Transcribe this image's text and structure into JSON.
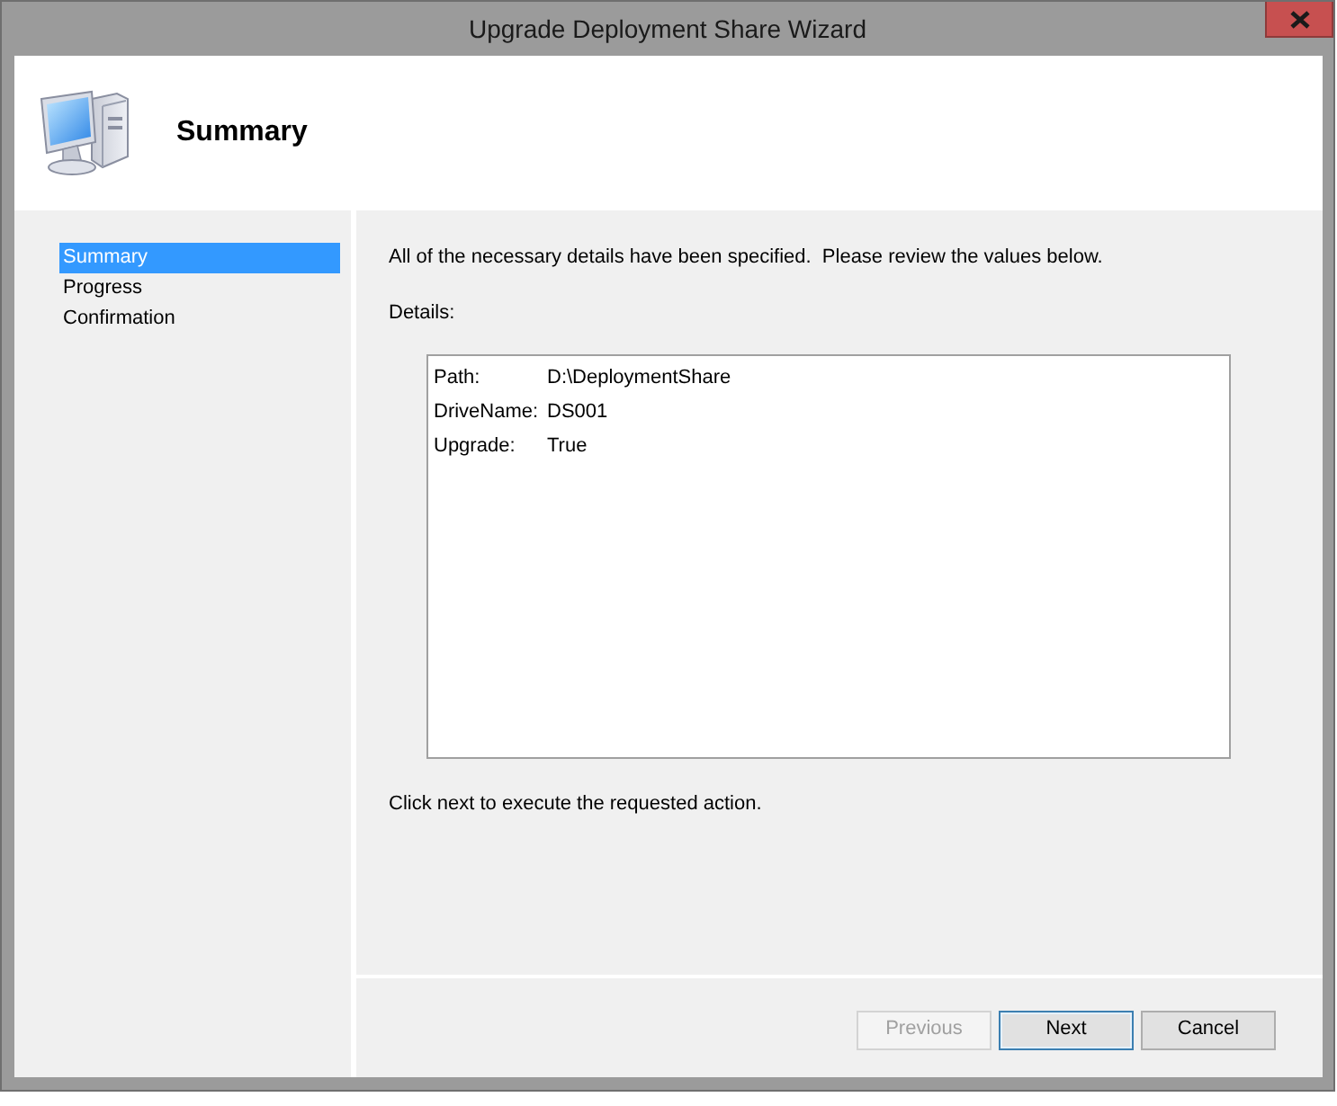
{
  "window": {
    "title": "Upgrade Deployment Share Wizard"
  },
  "header": {
    "title": "Summary"
  },
  "steps": [
    {
      "label": "Summary",
      "selected": true
    },
    {
      "label": "Progress",
      "selected": false
    },
    {
      "label": "Confirmation",
      "selected": false
    }
  ],
  "intro": "All of the necessary details have been specified.  Please review the values below.",
  "details_label": "Details:",
  "details": [
    {
      "name": "Path:",
      "value": "D:\\DeploymentShare"
    },
    {
      "name": "DriveName:",
      "value": "DS001"
    },
    {
      "name": "Upgrade:",
      "value": "True"
    }
  ],
  "footer_note": "Click next to execute the requested action.",
  "buttons": [
    {
      "label": "Previous",
      "disabled": true,
      "focused": false
    },
    {
      "label": "Next",
      "disabled": false,
      "focused": true
    },
    {
      "label": "Cancel",
      "disabled": false,
      "focused": false
    }
  ]
}
